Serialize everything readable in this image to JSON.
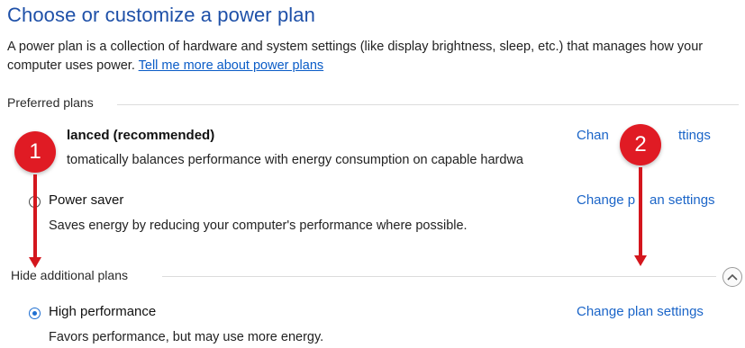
{
  "page": {
    "title": "Choose or customize a power plan",
    "intro_text": "A power plan is a collection of hardware and system settings (like display brightness, sleep, etc.) that manages how your computer uses power.",
    "intro_link": "Tell me more about power plans"
  },
  "preferred_plans": {
    "label": "Preferred plans",
    "plans": [
      {
        "name": "lanced (recommended)",
        "description": "tomatically balances performance with energy consumption on capable hardwa",
        "change_link": "Chan",
        "change_link_tail": "ttings",
        "selected": false
      },
      {
        "name": "Power saver",
        "description": "Saves energy by reducing your computer's performance where possible.",
        "change_link": "Change p",
        "change_link_tail": "an settings",
        "selected": false
      }
    ]
  },
  "additional_plans": {
    "label": "Hide additional plans",
    "plans": [
      {
        "name": "High performance",
        "description": "Favors performance, but may use more energy.",
        "change_link": "Change plan settings",
        "selected": true
      }
    ]
  },
  "annotations": {
    "badge_1": "1",
    "badge_2": "2",
    "color": "#e01b24"
  },
  "icons": {
    "collapse": "chevron-up-icon"
  }
}
